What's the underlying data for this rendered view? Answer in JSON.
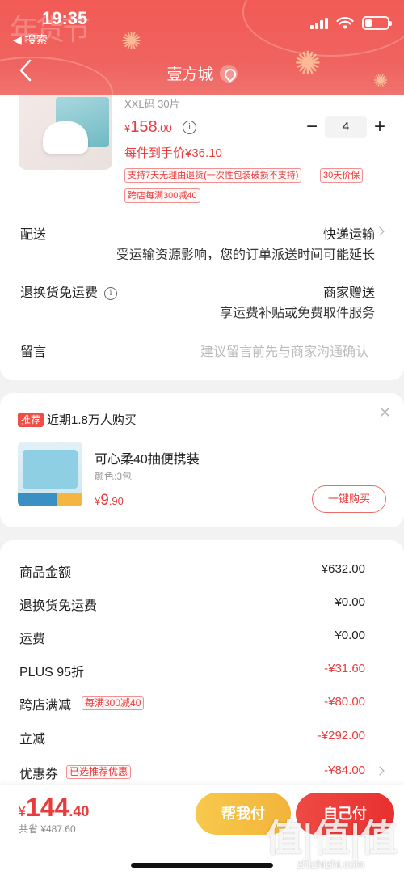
{
  "status_bar": {
    "time": "19:35",
    "back_app": "◀ 搜索"
  },
  "header": {
    "store_name": "壹方城",
    "deco_text": "年货节"
  },
  "product": {
    "spec": "XXL码 30片",
    "price_symbol": "¥",
    "price_main": "158",
    "price_decimal": ".00",
    "unit_price": "每件到手价¥36.10",
    "quantity": "4",
    "tags": [
      "支持7天无理由退货(一次性包装破损不支持)",
      "30天价保",
      "跨店每满300减40"
    ]
  },
  "delivery": {
    "label": "配送",
    "method": "快递运输",
    "note": "受运输资源影响，您的订单派送时间可能延长"
  },
  "return_shipping": {
    "label": "退换货免运费",
    "value": "商家赠送",
    "note": "享运费补贴或免费取件服务"
  },
  "message": {
    "label": "留言",
    "placeholder": "建议留言前先与商家沟通确认"
  },
  "recommend": {
    "badge": "推荐",
    "title": "近期1.8万人购买",
    "item_name": "可心柔40抽便携装",
    "variant": "颜色:3包",
    "price_symbol": "¥",
    "price_main": "9",
    "price_decimal": ".90",
    "buy_label": "一键购买"
  },
  "summary": {
    "items": [
      {
        "label": "商品金额",
        "value": "¥632.00",
        "red": false
      },
      {
        "label": "退换货免运费",
        "value": "¥0.00",
        "red": false
      },
      {
        "label": "运费",
        "value": "¥0.00",
        "red": false
      },
      {
        "label": "PLUS 95折",
        "value": "-¥31.60",
        "red": true
      },
      {
        "label": "跨店满减",
        "value": "-¥80.00",
        "red": true,
        "tag": "每满300减40"
      },
      {
        "label": "立减",
        "value": "-¥292.00",
        "red": true
      },
      {
        "label": "优惠券",
        "value": "-¥84.00",
        "red": true,
        "tag": "已选推荐优惠"
      }
    ]
  },
  "bottom_bar": {
    "total_symbol": "¥",
    "total_main": "144",
    "total_decimal": ".40",
    "saved": "共省 ¥487.60",
    "help_pay": "帮我付",
    "self_pay": "自己付"
  },
  "watermark": {
    "logo": "值|值|值",
    "url": "zhizhizhi.com"
  },
  "colors": {
    "brand_red": "#e93b3d",
    "header_red": "#f25a55",
    "help_yellow": "#f2b43a"
  }
}
